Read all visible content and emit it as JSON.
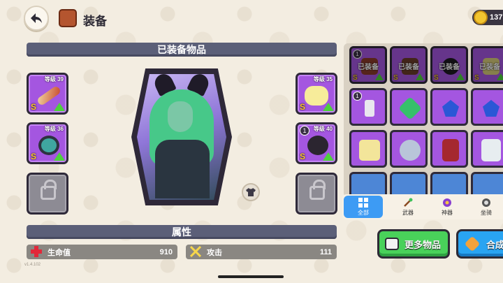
{
  "header": {
    "title": "装备",
    "coins": "137"
  },
  "equipped": {
    "section_title": "已装备物品",
    "slots": [
      {
        "level": "等级 39",
        "rarity": "S",
        "upgrade": true
      },
      {
        "level": "等级 36",
        "rarity": "S",
        "upgrade": true
      },
      {
        "level": "等级 35",
        "rarity": "S",
        "upgrade": true
      },
      {
        "level": "等级 40",
        "rarity": "S",
        "badge": "1",
        "upgrade": true
      }
    ]
  },
  "attributes": {
    "section_title": "属性",
    "hp_label": "生命值",
    "hp_value": "910",
    "atk_label": "攻击",
    "atk_value": "111"
  },
  "version": "v1.4.102",
  "inventory": {
    "equipped_label": "已装备",
    "row1": [
      {
        "badge": "1",
        "rarity": "S"
      },
      {
        "rarity": "S"
      },
      {
        "rarity": "S"
      },
      {
        "rarity": "S"
      }
    ],
    "row2": [
      {
        "badge": "1"
      }
    ]
  },
  "tabs": [
    {
      "label": "全部",
      "active": true
    },
    {
      "label": "武器"
    },
    {
      "label": "神器"
    },
    {
      "label": "坐骑"
    }
  ],
  "buttons": {
    "more": "更多物品",
    "merge": "合成"
  },
  "colors": {
    "epic": "#a456e0",
    "rare": "#4d86d6",
    "green_btn": "#49d15a",
    "blue_btn": "#29a4f2"
  }
}
